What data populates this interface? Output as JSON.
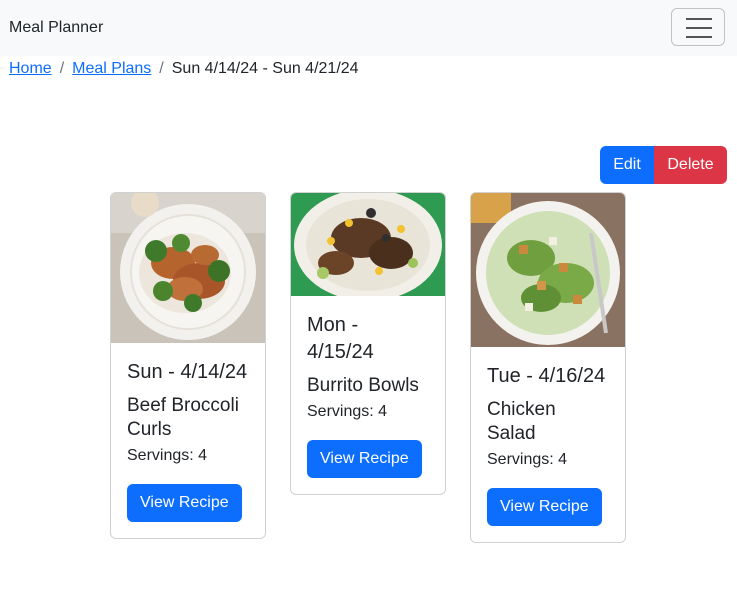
{
  "navbar": {
    "brand": "Meal Planner",
    "toggler_icon": "hamburger-menu-icon"
  },
  "breadcrumb": {
    "items": [
      "Home",
      "Meal Plans"
    ],
    "current": "Sun 4/14/24 - Sun 4/21/24",
    "separator": "/"
  },
  "actions": {
    "edit_label": "Edit",
    "delete_label": "Delete"
  },
  "cards": [
    {
      "day": "Sun - 4/14/24",
      "recipe": "Beef Broccoli Curls",
      "servings": "Servings: 4",
      "button": "View Recipe",
      "image": "beef-broccoli-photo"
    },
    {
      "day": "Mon - 4/15/24",
      "recipe": "Burrito Bowls",
      "servings": "Servings: 4",
      "button": "View Recipe",
      "image": "burrito-bowl-photo"
    },
    {
      "day": "Tue - 4/16/24",
      "recipe": "Chicken Salad",
      "servings": "Servings: 4",
      "button": "View Recipe",
      "image": "chicken-salad-photo"
    }
  ],
  "colors": {
    "primary": "#0d6efd",
    "danger": "#dc3545",
    "navbar_bg": "#f8f9fa"
  }
}
